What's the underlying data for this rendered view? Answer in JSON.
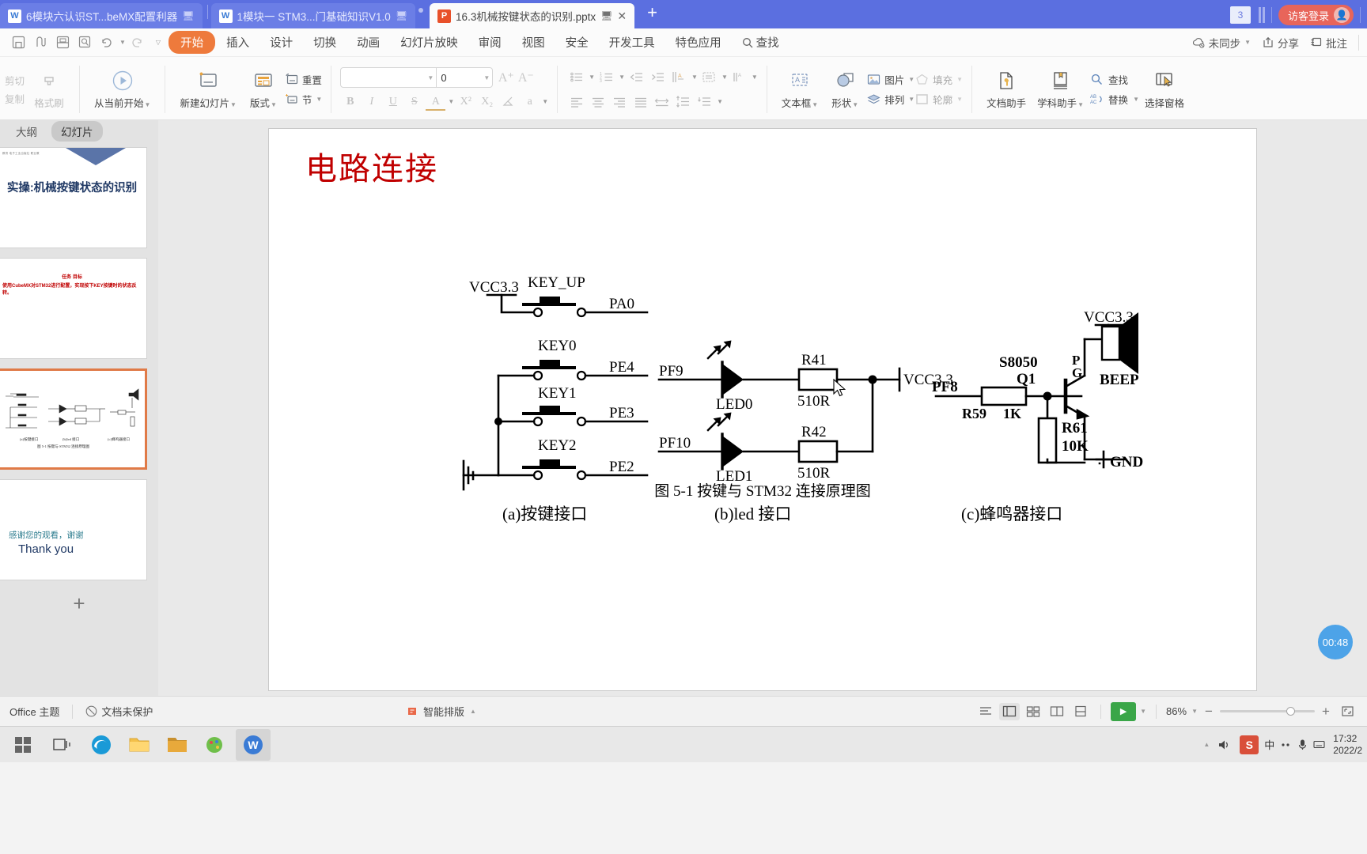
{
  "window": {
    "tabs": [
      {
        "label": "6模块六认识ST...beMX配置利器",
        "icon": "wps-writer-icon",
        "type": "w",
        "active": false
      },
      {
        "label": "1模块一 STM3...门基础知识V1.0",
        "icon": "wps-writer-icon",
        "type": "w",
        "active": false
      },
      {
        "label": "16.3机械按键状态的识别.pptx",
        "icon": "wps-presentation-icon",
        "type": "p",
        "active": true
      }
    ],
    "new_tab": "+",
    "tab_count_badge": "3",
    "login_label": "访客登录"
  },
  "menubar": {
    "quick_icons": [
      "save-icon",
      "print-preview-icon",
      "print-icon",
      "find-icon",
      "undo-icon",
      "redo-icon",
      "customize-icon"
    ],
    "tabs": [
      "开始",
      "插入",
      "设计",
      "切换",
      "动画",
      "幻灯片放映",
      "审阅",
      "视图",
      "安全",
      "开发工具",
      "特色应用"
    ],
    "active_tab": "开始",
    "search_label": "查找",
    "right_items": [
      "未同步",
      "分享",
      "批注"
    ]
  },
  "ribbon": {
    "clipboard": {
      "cut": "剪切",
      "copy": "复制",
      "format_painter": "格式刷"
    },
    "slides": {
      "from_current": "从当前开始",
      "new_slide": "新建幻灯片",
      "layout": "版式",
      "section": "节",
      "reset": "重置"
    },
    "font": {
      "font_name": "",
      "font_name_placeholder": "",
      "font_size": "0",
      "grow": "A⁺",
      "shrink": "A⁻",
      "bold": "B",
      "italic": "I",
      "underline": "U",
      "strike": "S",
      "font_color": "A",
      "superscript": "X²",
      "subscript": "X₂",
      "clear_format": "clear-format-icon",
      "char_shading": "a"
    },
    "paragraph": {
      "bullets": "bullet-list-icon",
      "numbering": "numbered-list-icon",
      "decrease_indent": "decrease-indent-icon",
      "increase_indent": "increase-indent-icon",
      "text_direction": "text-direction-icon",
      "align_left": "align-left-icon",
      "align_center": "align-center-icon",
      "align_right": "align-right-icon",
      "justify": "justify-icon",
      "distribute": "distribute-icon",
      "line_spacing": "line-spacing-icon",
      "columns": "columns-icon",
      "align_text": "align-text-icon"
    },
    "insert": {
      "textbox": "文本框",
      "shape": "形状",
      "picture": "图片",
      "arrange": "排列",
      "fill": "填充",
      "outline": "轮廓"
    },
    "tools": {
      "doc_assistant": "文档助手",
      "subject_assistant": "学科助手",
      "find": "查找",
      "replace": "替换",
      "selection_pane": "选择窗格"
    }
  },
  "sidebar": {
    "tabs": [
      "大纲",
      "幻灯片"
    ],
    "active_tab": "幻灯片",
    "thumbnails": [
      {
        "index": 1,
        "kind": "title",
        "header_small": "教育 电子工业出版社 职业教",
        "title": "实操:机械按键状态的识别",
        "selected": false
      },
      {
        "index": 2,
        "kind": "text",
        "heading": "任务 目标",
        "body": "使用CubeMX对STM32进行配置，实现按下KEY按键时的状态反转。",
        "selected": false
      },
      {
        "index": 3,
        "kind": "circuit",
        "selected": true
      },
      {
        "index": 4,
        "kind": "thanks",
        "line1": "感谢您的观看，谢谢",
        "line2": "Thank you",
        "selected": false
      }
    ],
    "add_slide": "+"
  },
  "slide": {
    "title": "电路连接",
    "figure_caption": "图 5-1  按键与 STM32 连接原理图",
    "sections": [
      {
        "label": "(a)按键接口"
      },
      {
        "label": "(b)led 接口"
      },
      {
        "label": "(c)蜂鸣器接口"
      }
    ],
    "circuit": {
      "keys": {
        "vcc": "VCC3.3",
        "switches": [
          {
            "name": "KEY_UP",
            "net": "PA0"
          },
          {
            "name": "KEY0",
            "net": "PE4"
          },
          {
            "name": "KEY1",
            "net": "PE3"
          },
          {
            "name": "KEY2",
            "net": "PE2"
          }
        ]
      },
      "leds": {
        "vcc": "VCC3.3",
        "items": [
          {
            "pin": "PF9",
            "led": "LED0",
            "res_name": "R41",
            "res_value": "510R"
          },
          {
            "pin": "PF10",
            "led": "LED1",
            "res_name": "R42",
            "res_value": "510R"
          }
        ]
      },
      "buzzer": {
        "vcc": "VCC3.3",
        "pin": "PF8",
        "base_res_name": "R59",
        "base_res_value": "1K",
        "transistor_type": "S8050",
        "transistor_ref": "Q1",
        "pulldown_name": "R61",
        "pulldown_value": "10K",
        "speaker_label": "BEEP",
        "speaker_pins": "P G",
        "gnd": "GND"
      }
    }
  },
  "statusbar": {
    "theme": "Office 主题",
    "protection": "文档未保护",
    "smart_layout": "智能排版",
    "zoom_level": "86%",
    "zoom_out": "−",
    "zoom_in": "+",
    "timer_badge": "00:48"
  },
  "taskbar": {
    "start": "start-icon",
    "task_view": "task-view-icon",
    "apps": [
      "edge-icon",
      "file-explorer-icon",
      "folder-icon",
      "paint-icon",
      "wps-writer-icon"
    ],
    "tray": {
      "ime_lang": "中",
      "wps_badge": "S",
      "time": "17:32",
      "date": "2022/2"
    }
  },
  "colors": {
    "tab_bar_blue": "#5b6fe0",
    "accent_orange": "#ee7a3c",
    "title_red": "#c00000",
    "selected_thumb": "#e07a47",
    "play_green": "#3aa648",
    "badge_blue": "#4da3e8"
  }
}
